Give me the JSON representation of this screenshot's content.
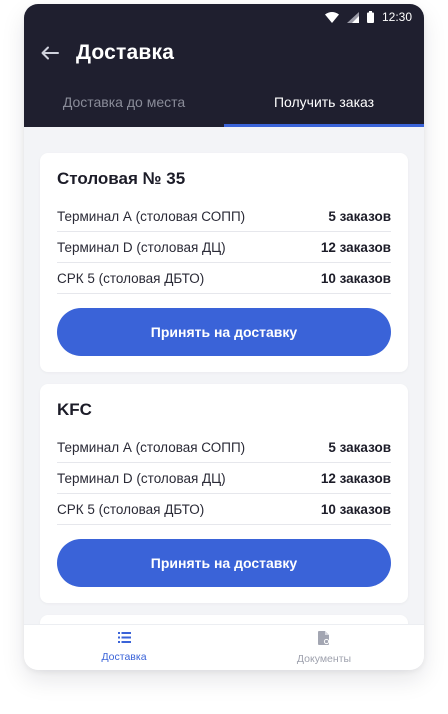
{
  "status_bar": {
    "time": "12:30",
    "icons": [
      "wifi-icon",
      "signal-icon",
      "battery-icon"
    ]
  },
  "header": {
    "title": "Доставка",
    "back_icon": "arrow-left-icon"
  },
  "tabs": [
    {
      "label": "Доставка до места",
      "active": false
    },
    {
      "label": "Получить заказ",
      "active": true
    }
  ],
  "cards": [
    {
      "title": "Столовая № 35",
      "rows": [
        {
          "name": "Терминал А (столовая СОПП)",
          "count": "5 заказов"
        },
        {
          "name": "Терминал D (столовая ДЦ)",
          "count": "12 заказов"
        },
        {
          "name": "СРК 5 (столовая ДБТО)",
          "count": "10 заказов"
        }
      ],
      "button_label": "Принять на доставку"
    },
    {
      "title": "KFC",
      "rows": [
        {
          "name": "Терминал А (столовая СОПП)",
          "count": "5 заказов"
        },
        {
          "name": "Терминал D (столовая ДЦ)",
          "count": "12 заказов"
        },
        {
          "name": "СРК 5 (столовая ДБТО)",
          "count": "10 заказов"
        }
      ],
      "button_label": "Принять на доставку"
    }
  ],
  "bottom_nav": [
    {
      "label": "Доставка",
      "icon": "list-icon",
      "active": true
    },
    {
      "label": "Документы",
      "icon": "document-icon",
      "active": false
    }
  ],
  "colors": {
    "header_bg": "#1f1f2f",
    "accent": "#3a63d8",
    "page_bg": "#f3f4f7"
  }
}
